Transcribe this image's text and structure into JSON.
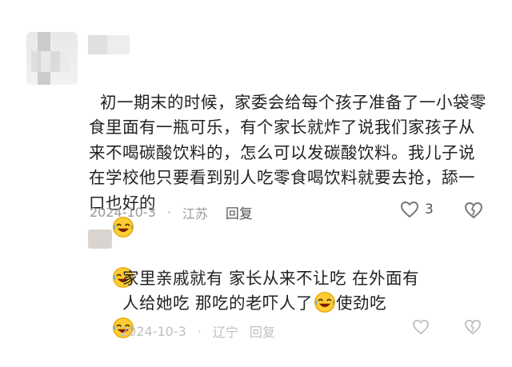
{
  "comment": {
    "text": "初一期末的时候，家委会给每个孩子准备了一小袋零食里面有一瓶可乐，有个家长就炸了说我们家孩子从来不喝碳酸饮料的，怎么可以发碳酸饮料。我儿子说在学校他只要看到别人吃零食喝饮料就要去抢，舔一口也好的",
    "date": "2024-10-3",
    "location": "江苏",
    "reply_label": "回复",
    "like_count": "3"
  },
  "reply": {
    "text_line1": "家里亲戚就有  家长从来不让吃  在外面有",
    "text_line2": "人给她吃  那吃的老吓人了",
    "text_tail": "使劲吃",
    "date": "2024-10-3",
    "location": "辽宁",
    "reply_label": "回复"
  },
  "icons": {
    "emoji": "laughing-crying-emoji",
    "like": "heart-outline-icon",
    "dislike": "broken-heart-outline-icon"
  }
}
